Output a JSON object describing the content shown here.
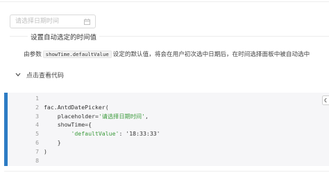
{
  "picker": {
    "placeholder": "请选择日期时间",
    "icon": "calendar-icon"
  },
  "section": {
    "title": "设置自动选定的时间值",
    "desc_prefix": "由参数",
    "desc_code": "showTime.defaultValue",
    "desc_suffix": "设定的默认值，将会在用户初次选中日期后，在时间选择面板中被自动选中"
  },
  "toggle": {
    "label": "点击查看代码",
    "icon": "chevron-down-icon"
  },
  "code": {
    "copy_icon": "copy-icon",
    "accent_color": "#2d7cc4",
    "lines": [
      {
        "num": "1",
        "plain": "",
        "str": "",
        "tail": ""
      },
      {
        "num": "2",
        "plain": "fac.AntdDatePicker(",
        "str": "",
        "tail": ""
      },
      {
        "num": "3",
        "plain": "    placeholder=",
        "str": "'请选择日期时间'",
        "tail": ","
      },
      {
        "num": "4",
        "plain": "    showTime={",
        "str": "",
        "tail": ""
      },
      {
        "num": "5",
        "plain": "        ",
        "str": "'defaultValue'",
        "tail": ": '18:33:33'"
      },
      {
        "num": "6",
        "plain": "    }",
        "str": "",
        "tail": ""
      },
      {
        "num": "7",
        "plain": ")",
        "str": "",
        "tail": ""
      },
      {
        "num": "8",
        "plain": "",
        "str": "",
        "tail": ""
      }
    ]
  }
}
